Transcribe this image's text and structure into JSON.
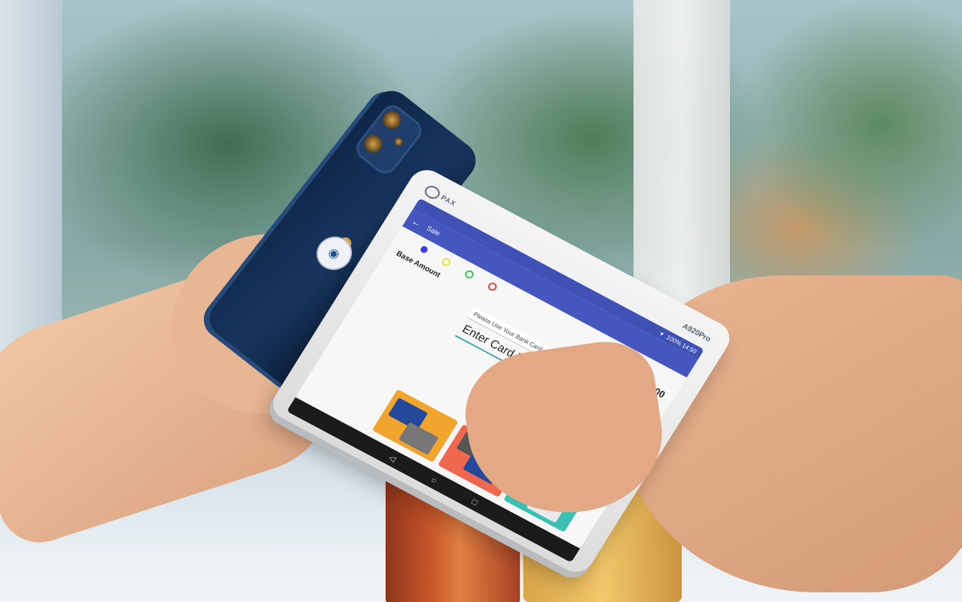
{
  "terminal": {
    "brand": "PAX",
    "model": "A920Pro",
    "status_time": "100% 14:50",
    "app_title": "Sale",
    "base_amount_label": "Base Amount",
    "amount": "$1.00",
    "card_prompt": "Please Use Your Bank Card",
    "manual_entry_label": "Enter Card Number Manually",
    "indicator_colors": [
      "#3b3be0",
      "#e8e030",
      "#2fc44a",
      "#e23a3a"
    ],
    "card_tile_colors": [
      "#f2a52c",
      "#f0674f",
      "#3bc1b4"
    ],
    "nav": [
      "◁",
      "○",
      "□"
    ]
  },
  "phone": {
    "logo": ""
  }
}
